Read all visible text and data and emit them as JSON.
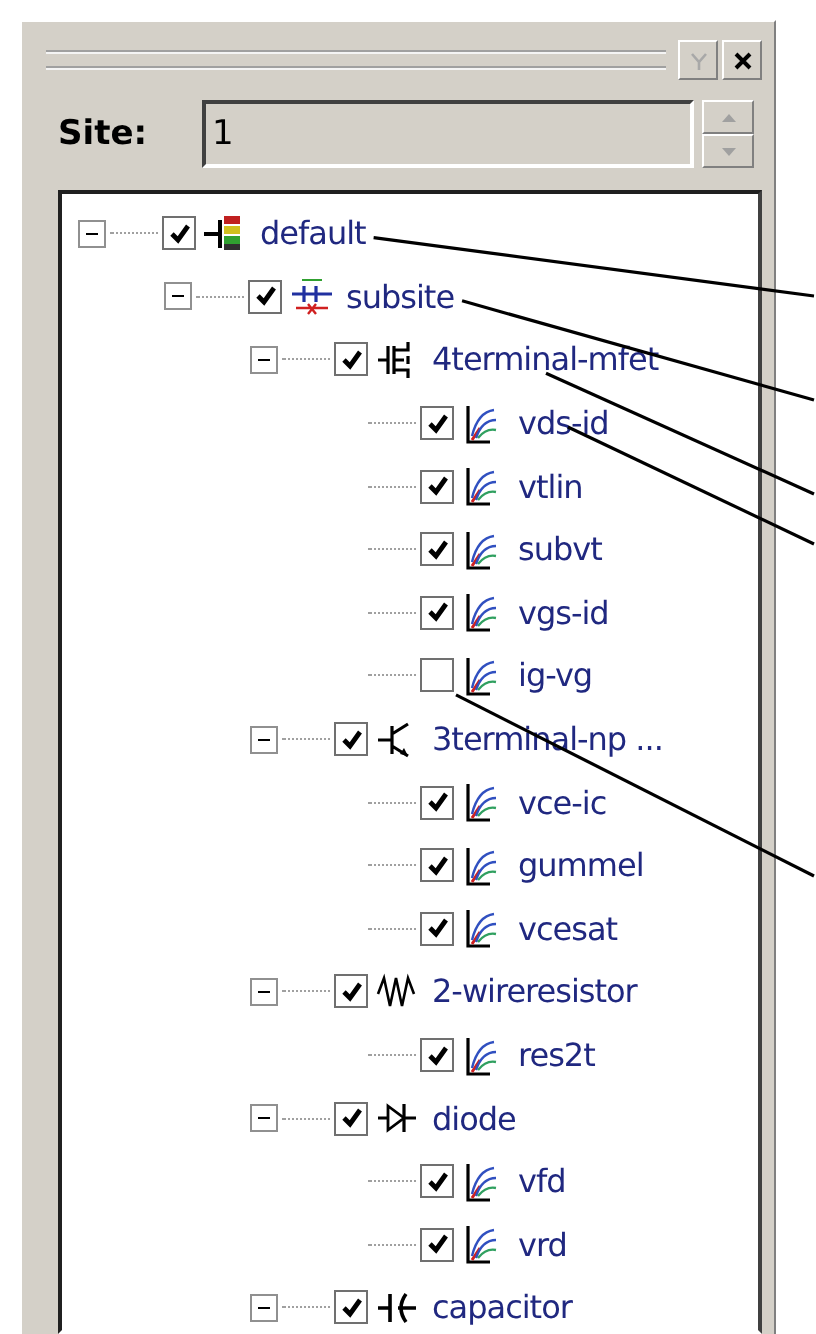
{
  "site_field": {
    "label": "Site:",
    "value": "1"
  },
  "tree": [
    {
      "label": "default",
      "kind": "site",
      "checked": true,
      "expanded": true,
      "callout": true,
      "children": [
        {
          "label": "subsite",
          "kind": "subsite",
          "checked": true,
          "expanded": true,
          "callout": true,
          "children": [
            {
              "label": "4terminal-mfet",
              "kind": "mosfet",
              "checked": true,
              "expanded": true,
              "callout": true,
              "children": [
                {
                  "label": "vds-id",
                  "kind": "setup",
                  "checked": true,
                  "callout": true
                },
                {
                  "label": "vtlin",
                  "kind": "setup",
                  "checked": true
                },
                {
                  "label": "subvt",
                  "kind": "setup",
                  "checked": true
                },
                {
                  "label": "vgs-id",
                  "kind": "setup",
                  "checked": true
                },
                {
                  "label": "ig-vg",
                  "kind": "setup",
                  "checked": false,
                  "callout": true
                }
              ]
            },
            {
              "label": "3terminal-np ...",
              "kind": "bjt",
              "checked": true,
              "expanded": true,
              "children": [
                {
                  "label": "vce-ic",
                  "kind": "setup",
                  "checked": true
                },
                {
                  "label": "gummel",
                  "kind": "setup",
                  "checked": true
                },
                {
                  "label": "vcesat",
                  "kind": "setup",
                  "checked": true
                }
              ]
            },
            {
              "label": "2-wireresistor",
              "kind": "resistor",
              "checked": true,
              "expanded": true,
              "children": [
                {
                  "label": "res2t",
                  "kind": "setup",
                  "checked": true
                }
              ]
            },
            {
              "label": "diode",
              "kind": "diode",
              "checked": true,
              "expanded": true,
              "children": [
                {
                  "label": "vfd",
                  "kind": "setup",
                  "checked": true
                },
                {
                  "label": "vrd",
                  "kind": "setup",
                  "checked": true
                }
              ]
            },
            {
              "label": "capacitor",
              "kind": "capacitor",
              "checked": true,
              "expanded": true
            }
          ]
        }
      ]
    }
  ]
}
